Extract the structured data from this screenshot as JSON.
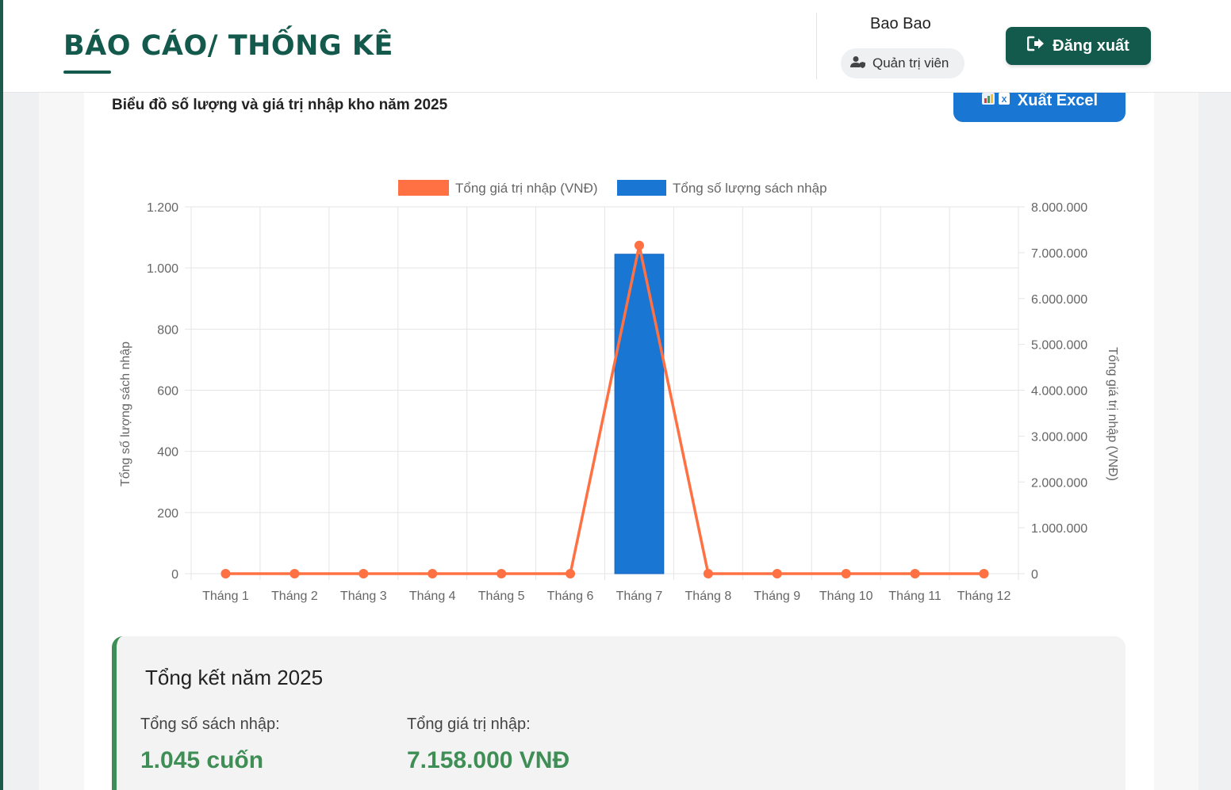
{
  "header": {
    "title": "BÁO CÁO/ THỐNG KÊ",
    "user_name": "Bao Bao",
    "role": "Quản trị viên",
    "logout_label": "Đăng xuất"
  },
  "report": {
    "chart_title": "Biểu đồ số lượng và giá trị nhập kho năm 2025",
    "export_label": "Xuất Excel"
  },
  "chart_data": {
    "type": "bar",
    "categories": [
      "Tháng 1",
      "Tháng 2",
      "Tháng 3",
      "Tháng 4",
      "Tháng 5",
      "Tháng 6",
      "Tháng 7",
      "Tháng 8",
      "Tháng 9",
      "Tháng 10",
      "Tháng 11",
      "Tháng 12"
    ],
    "series": [
      {
        "name": "Tổng giá trị nhập (VNĐ)",
        "type": "line",
        "axis": "right",
        "color": "#ff7043",
        "values": [
          0,
          0,
          0,
          0,
          0,
          0,
          7158000,
          0,
          0,
          0,
          0,
          0
        ]
      },
      {
        "name": "Tổng số lượng sách nhập",
        "type": "bar",
        "axis": "left",
        "color": "#1976d2",
        "values": [
          0,
          0,
          0,
          0,
          0,
          0,
          1045,
          0,
          0,
          0,
          0,
          0
        ]
      }
    ],
    "y_left": {
      "label": "Tổng số lượng sách nhập",
      "ylim": [
        0,
        1200
      ],
      "ticks": [
        "0",
        "200",
        "400",
        "600",
        "800",
        "1.000",
        "1.200"
      ]
    },
    "y_right": {
      "label": "Tổng giá trị nhập (VNĐ)",
      "ylim": [
        0,
        8000000
      ],
      "ticks": [
        "0",
        "1.000.000",
        "2.000.000",
        "3.000.000",
        "4.000.000",
        "5.000.000",
        "6.000.000",
        "7.000.000",
        "8.000.000"
      ]
    },
    "grid": true,
    "legend": "top-center"
  },
  "summary": {
    "title": "Tổng kết năm 2025",
    "books_label": "Tổng số sách nhập:",
    "books_value": "1.045 cuốn",
    "value_label": "Tổng giá trị nhập:",
    "value_value": "7.158.000 VNĐ"
  },
  "colors": {
    "brand": "#145a4c",
    "accent_blue": "#1976d2",
    "line_orange": "#ff7043",
    "success_green": "#3e8e55"
  }
}
